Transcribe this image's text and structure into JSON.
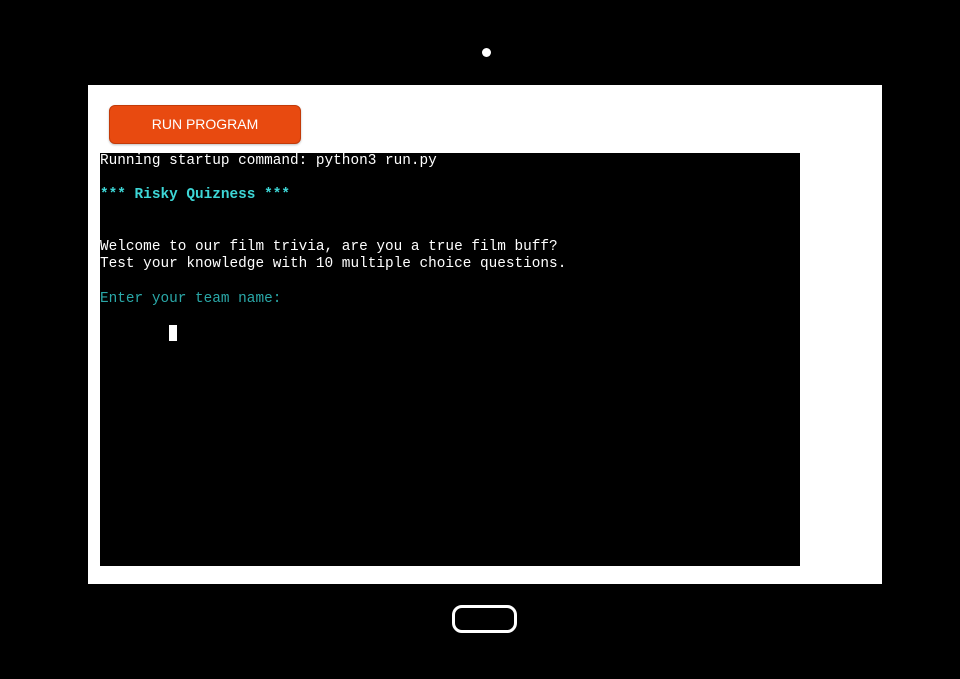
{
  "run_button": {
    "label": "RUN PROGRAM"
  },
  "terminal": {
    "lines": [
      {
        "text": "Running startup command: python3 run.py",
        "color": "#ffffff"
      },
      {
        "text": "",
        "color": "#ffffff"
      },
      {
        "text": "*** Risky Quizness ***",
        "color": "#3dd6d6"
      },
      {
        "text": "",
        "color": "#ffffff"
      },
      {
        "text": "",
        "color": "#ffffff"
      },
      {
        "text": "Welcome to our film trivia, are you a true film buff?",
        "color": "#ffffff"
      },
      {
        "text": "Test your knowledge with 10 multiple choice questions.",
        "color": "#ffffff"
      },
      {
        "text": "",
        "color": "#ffffff"
      },
      {
        "text": "Enter your team name:",
        "color": "#2aa8a8"
      }
    ]
  },
  "colors": {
    "button": "#e84a10",
    "terminal_bg": "#000000",
    "title": "#3dd6d6",
    "prompt": "#2aa8a8"
  }
}
